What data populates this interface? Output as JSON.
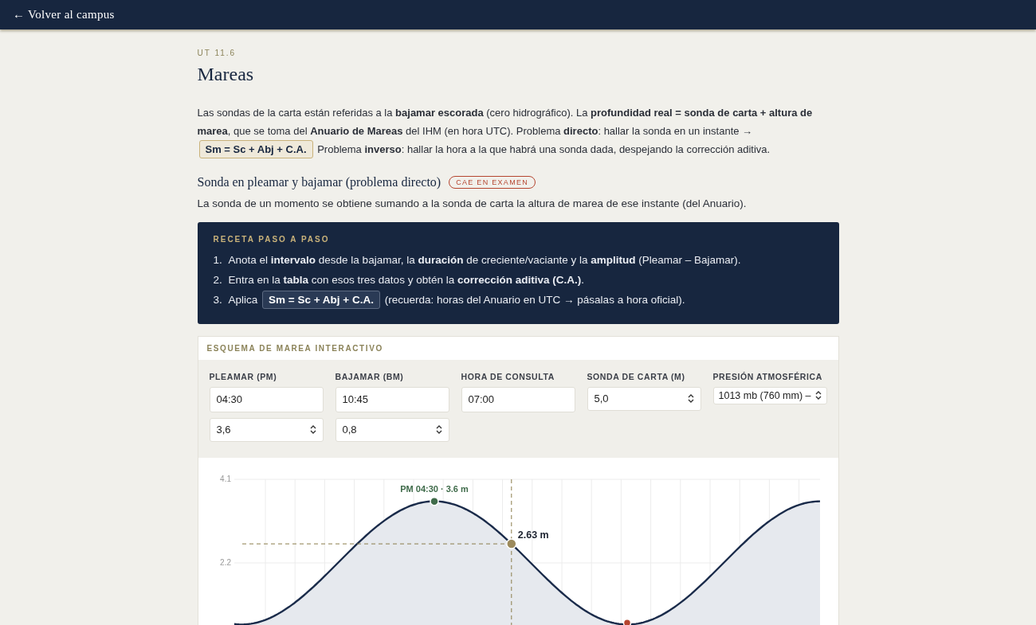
{
  "nav": {
    "back_link": "← Volver al campus"
  },
  "lesson": {
    "code": "UT 11.6",
    "title": "Mareas"
  },
  "intro": [
    {
      "kind": "text",
      "text": "Las sondas de la carta están referidas a la **bajamar escorada** (cero hidrográfico). La **profundidad real = sonda de carta + altura de marea**, que se toma del **Anuario de Mareas** del IHM (en hora UTC). Problema **directo**: hallar la sonda en un instante →"
    },
    {
      "kind": "formula",
      "text": "Sm = Sc + Abj + C.A."
    },
    {
      "kind": "text",
      "text": "Problema **inverso**: hallar la hora a la que habrá una sonda dada, despejando la corrección aditiva."
    }
  ],
  "section": {
    "title": "Sonda en pleamar y bajamar (problema directo)",
    "badge": "CAE EN EXAMEN",
    "text": "La sonda de un momento se obtiene sumando a la sonda de carta la altura de marea de ese instante (del Anuario)."
  },
  "recipe": {
    "title": "RECETA PASO A PASO",
    "steps": [
      {
        "number": "1.",
        "parts": [
          {
            "kind": "text",
            "text": "Anota el **intervalo** desde la bajamar, la **duración** de creciente/vaciante y la **amplitud** (Pleamar – Bajamar)."
          }
        ]
      },
      {
        "number": "2.",
        "parts": [
          {
            "kind": "text",
            "text": "Entra en la **tabla** con esos tres datos y obtén la **corrección aditiva (C.A.)**."
          }
        ]
      },
      {
        "number": "3.",
        "parts": [
          {
            "kind": "text",
            "text": "Aplica"
          },
          {
            "kind": "formula",
            "text": "Sm = Sc + Abj + C.A."
          },
          {
            "kind": "text",
            "text": "(recuerda: horas del Anuario en UTC → pásalas a hora oficial)."
          }
        ]
      }
    ]
  },
  "tide_panel": {
    "title": "ESQUEMA DE MAREA INTERACTIVO",
    "fields": [
      {
        "label": "PLEAMAR (PM)",
        "inputs": [
          {
            "kind": "time",
            "value": "04:30"
          },
          {
            "kind": "number",
            "value": "3,6"
          }
        ]
      },
      {
        "label": "BAJAMAR (BM)",
        "inputs": [
          {
            "kind": "time",
            "value": "10:45"
          },
          {
            "kind": "number",
            "value": "0,8"
          }
        ]
      },
      {
        "label": "HORA DE CONSULTA",
        "inputs": [
          {
            "kind": "time",
            "value": "07:00"
          }
        ]
      },
      {
        "label": "SONDA DE CARTA (M)",
        "inputs": [
          {
            "kind": "number",
            "value": "5,0"
          }
        ]
      },
      {
        "label": "PRESIÓN ATMOSFÉRICA",
        "inputs": [
          {
            "kind": "select",
            "value": "1013 mb (760 mm) –"
          }
        ]
      }
    ],
    "chart": {
      "y_labels": [
        "4.1",
        "2.2"
      ],
      "high_label": "PM 04:30 · 3.6 m",
      "reading": "2.63 m"
    }
  }
}
